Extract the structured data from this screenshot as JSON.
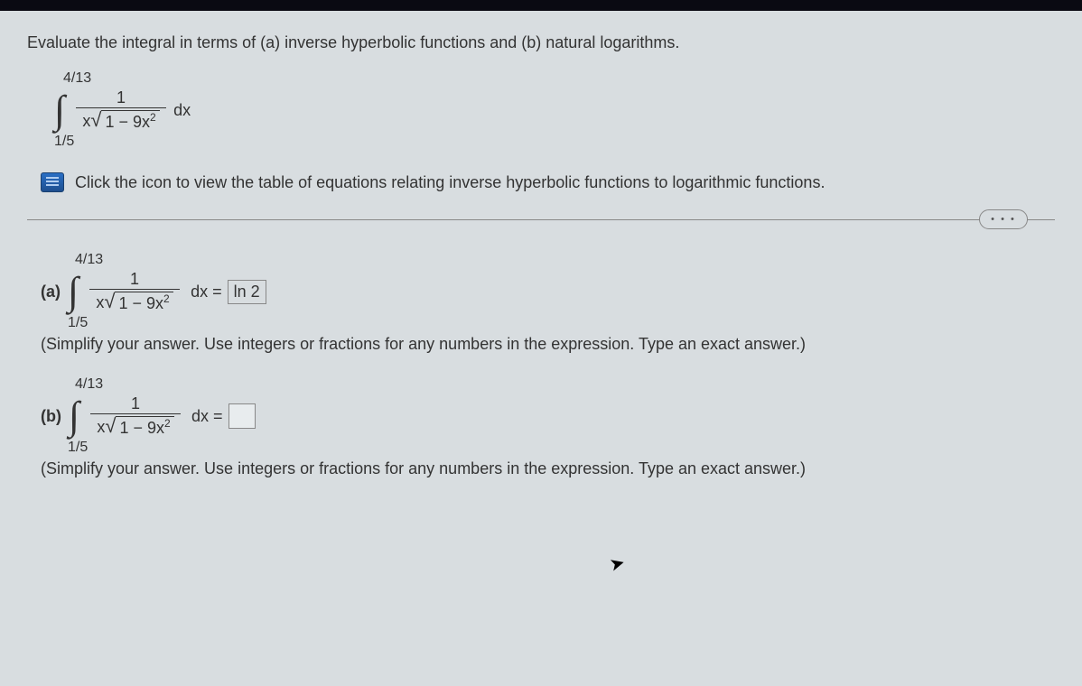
{
  "prompt": "Evaluate the integral in terms of (a) inverse hyperbolic functions and (b) natural logarithms.",
  "upper_limit": "4/13",
  "lower_limit": "1/5",
  "integrand_numerator": "1",
  "integrand_denom_x": "x",
  "integrand_denom_sqrt": "1 − 9x",
  "integrand_denom_sqrt_exp": "2",
  "dx": "dx",
  "table_link_text": "Click the icon to view the table of equations relating inverse hyperbolic functions to logarithmic functions.",
  "more_label": "• • •",
  "part_a": {
    "label": "(a)",
    "upper_limit": "4/13",
    "lower_limit": "1/5",
    "equals": "dx =",
    "answer": "ln 2"
  },
  "part_b": {
    "label": "(b)",
    "upper_limit": "4/13",
    "lower_limit": "1/5",
    "equals": "dx =",
    "answer": ""
  },
  "instruction_text": "(Simplify your answer. Use integers or fractions for any numbers in the expression. Type an exact answer.)"
}
